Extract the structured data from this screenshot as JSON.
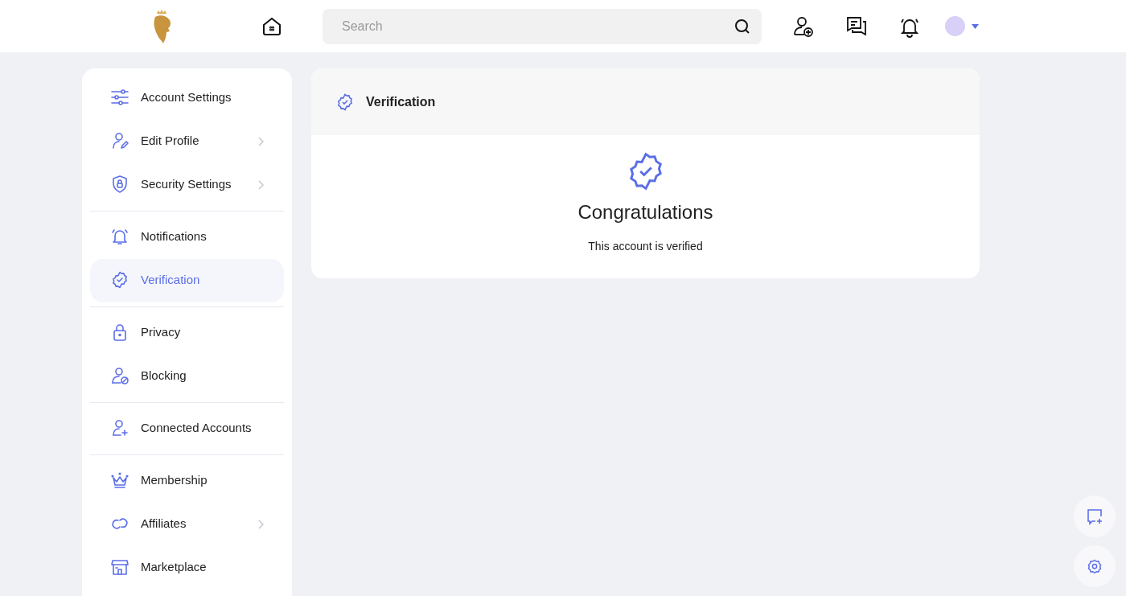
{
  "header": {
    "search": {
      "placeholder": "Search"
    }
  },
  "sidebar": {
    "groups": [
      [
        {
          "label": "Account Settings",
          "selected": false,
          "has_submenu": false
        },
        {
          "label": "Edit Profile",
          "selected": false,
          "has_submenu": true
        },
        {
          "label": "Security Settings",
          "selected": false,
          "has_submenu": true
        }
      ],
      [
        {
          "label": "Notifications",
          "selected": false,
          "has_submenu": false
        },
        {
          "label": "Verification",
          "selected": true,
          "has_submenu": false
        }
      ],
      [
        {
          "label": "Privacy",
          "selected": false,
          "has_submenu": false
        },
        {
          "label": "Blocking",
          "selected": false,
          "has_submenu": false
        }
      ],
      [
        {
          "label": "Connected Accounts",
          "selected": false,
          "has_submenu": false
        }
      ],
      [
        {
          "label": "Membership",
          "selected": false,
          "has_submenu": false
        },
        {
          "label": "Affiliates",
          "selected": false,
          "has_submenu": true
        },
        {
          "label": "Marketplace",
          "selected": false,
          "has_submenu": false
        }
      ]
    ]
  },
  "panel": {
    "title": "Verification",
    "heading": "Congratulations",
    "message": "This account is verified"
  }
}
